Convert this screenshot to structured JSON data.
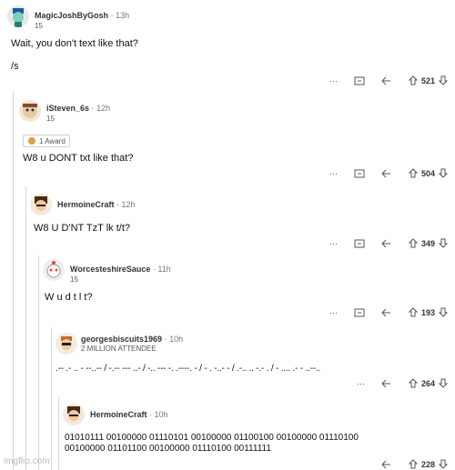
{
  "comments": [
    {
      "author": "MagicJoshByGosh",
      "time": "13h",
      "score_small": "15",
      "lines": [
        "Wait, you don't text like that?",
        "/s"
      ],
      "votes": "521"
    },
    {
      "author": "iSteven_6s",
      "time": "12h",
      "score_small": "15",
      "award": "1 Award",
      "lines": [
        "W8 u DONT txt like that?"
      ],
      "votes": "504"
    },
    {
      "author": "HermoineCraft",
      "time": "12h",
      "lines": [
        "W8 U D'NT TzT lk t/t?"
      ],
      "votes": "349"
    },
    {
      "author": "WorcesteshireSauce",
      "time": "11h",
      "score_small": "15",
      "lines": [
        "W u d t l t?"
      ],
      "votes": "193"
    },
    {
      "author": "georgesbiscuits1969",
      "time": "10h",
      "flair": "2 MILLION ATTENDEE",
      "lines": [
        ".-- .- .. - --..-- / -.-- --- ..- / -.. --- -. .----. - / - . -..- - / .-.. .. -.- . / - .... .- - ..--.."
      ],
      "votes": "264"
    },
    {
      "author": "HermoineCraft",
      "time": "10h",
      "lines": [
        "01010111 00100000 01110101 00100000 01100100 00100000 01110100",
        "00100000 01101100 00100000 01110100 00111111"
      ],
      "votes": "228"
    }
  ],
  "dot": "·",
  "more": "···",
  "watermark": "imgflip.com",
  "icons": {
    "more": "more-icon",
    "save": "save-icon",
    "reply": "reply-icon",
    "upvote": "upvote-arrow-icon",
    "downvote": "downvote-arrow-icon",
    "award": "award-icon"
  }
}
